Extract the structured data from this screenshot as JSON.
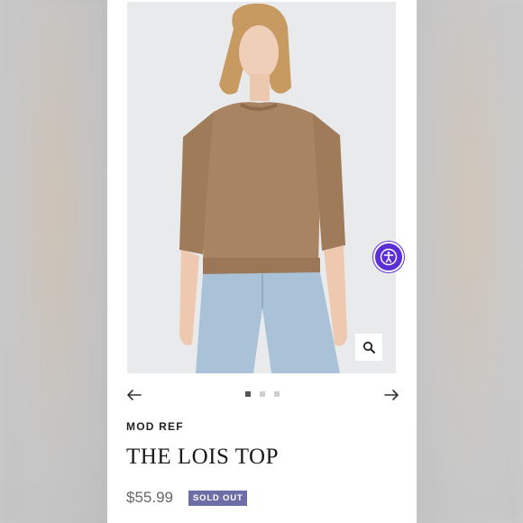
{
  "product": {
    "brand": "MOD REF",
    "title": "THE LOIS TOP",
    "price": "$55.99",
    "badge": "SOLD OUT"
  },
  "gallery": {
    "slide_count": 3,
    "active_slide": 1,
    "icons": {
      "prev": "arrow-left-icon",
      "next": "arrow-right-icon",
      "zoom": "magnifier-icon",
      "accessibility": "accessibility-icon"
    }
  },
  "colors": {
    "badge": "#6e6ea6",
    "accessibility_button": "#5b2fd6",
    "garment": "#a98462",
    "denim": "#a9c2d8"
  }
}
